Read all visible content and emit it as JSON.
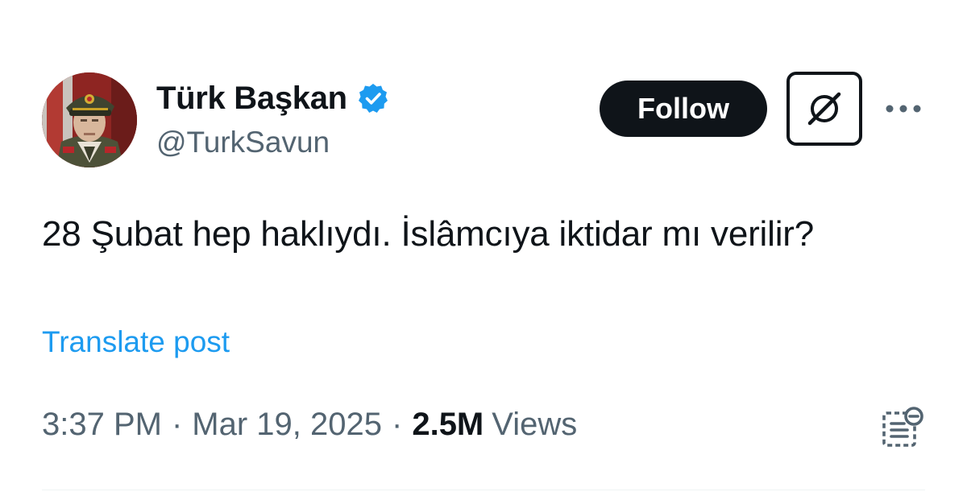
{
  "author": {
    "display_name": "Türk Başkan",
    "handle": "@TurkSavun",
    "verified": true,
    "verified_color": "#1d9bf0",
    "avatar_icon": "military-officer-avatar"
  },
  "actions": {
    "follow_label": "Follow",
    "grok_icon": "grok-icon",
    "more_icon": "more-options-icon"
  },
  "tweet": {
    "text": "28 Şubat hep haklıydı. İslâmcıya iktidar mı verilir?",
    "translate_label": "Translate post",
    "time": "3:37 PM",
    "date": "Mar 19, 2025",
    "views_count": "2.5M",
    "views_label": "Views",
    "separator": "·",
    "analytics_icon": "analytics-icon"
  },
  "colors": {
    "text_primary": "#0f1419",
    "text_secondary": "#536471",
    "link": "#1d9bf0",
    "follow_bg": "#0f1419"
  }
}
